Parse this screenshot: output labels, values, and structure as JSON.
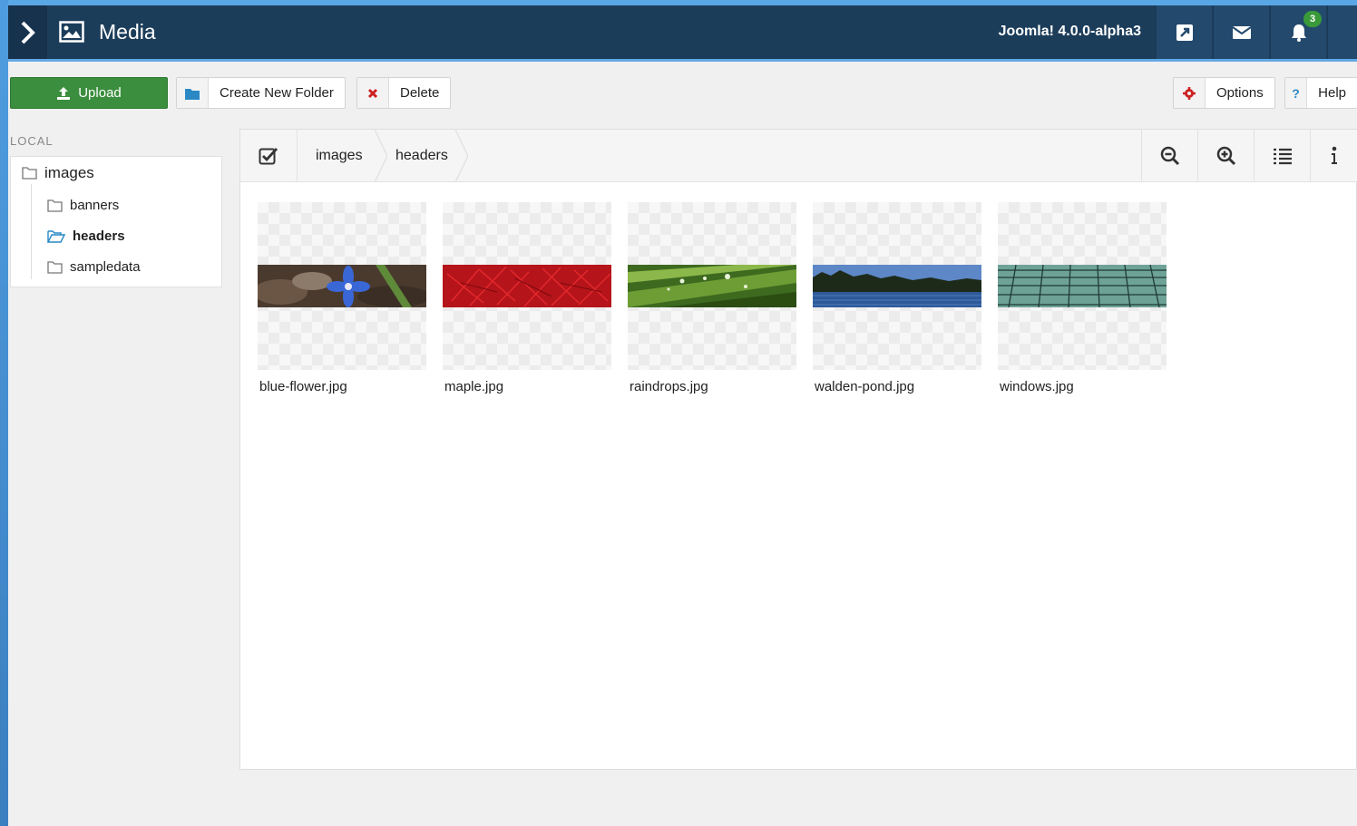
{
  "header": {
    "title": "Media",
    "version": "Joomla! 4.0.0-alpha3",
    "notifications_count": "3"
  },
  "toolbar": {
    "upload_label": "Upload",
    "create_folder_label": "Create New Folder",
    "delete_label": "Delete",
    "options_label": "Options",
    "help_label": "Help",
    "help_glyph": "?"
  },
  "sidebar": {
    "section_label": "LOCAL",
    "root": "images",
    "folders": [
      {
        "label": "banners",
        "active": false
      },
      {
        "label": "headers",
        "active": true
      },
      {
        "label": "sampledata",
        "active": false
      }
    ]
  },
  "browser": {
    "breadcrumbs": [
      "images",
      "headers"
    ],
    "files": [
      {
        "name": "blue-flower.jpg",
        "thumb": "blue-flower"
      },
      {
        "name": "maple.jpg",
        "thumb": "maple"
      },
      {
        "name": "raindrops.jpg",
        "thumb": "raindrops"
      },
      {
        "name": "walden-pond.jpg",
        "thumb": "walden-pond"
      },
      {
        "name": "windows.jpg",
        "thumb": "windows"
      }
    ]
  },
  "colors": {
    "header_bg": "#1c3d5a",
    "accent_blue": "#62a8e4",
    "upload_green": "#3b8e3d",
    "delete_red": "#cc2222",
    "badge_green": "#3a9a3a"
  }
}
